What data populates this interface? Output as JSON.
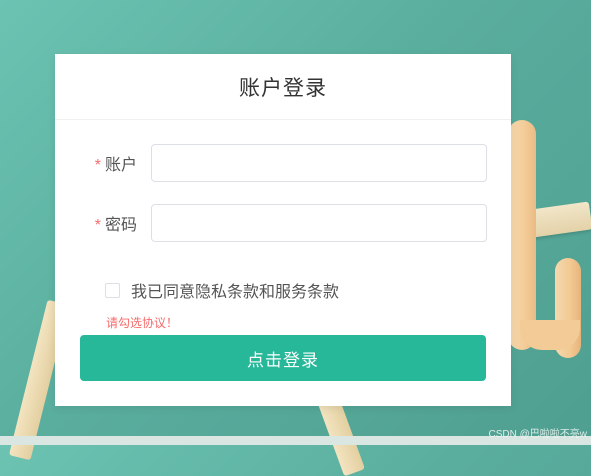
{
  "login": {
    "title": "账户登录",
    "account": {
      "required_mark": "*",
      "label": "账户",
      "value": "",
      "placeholder": ""
    },
    "password": {
      "required_mark": "*",
      "label": "密码",
      "value": "",
      "placeholder": ""
    },
    "agreement": {
      "checked": false,
      "text": "我已同意隐私条款和服务条款",
      "error": "请勾选协议！"
    },
    "submit_label": "点击登录"
  },
  "watermark": "CSDN @巴啦啦不亮w",
  "colors": {
    "accent": "#26b899",
    "error": "#f56c6c",
    "background": "#5aae9e"
  }
}
